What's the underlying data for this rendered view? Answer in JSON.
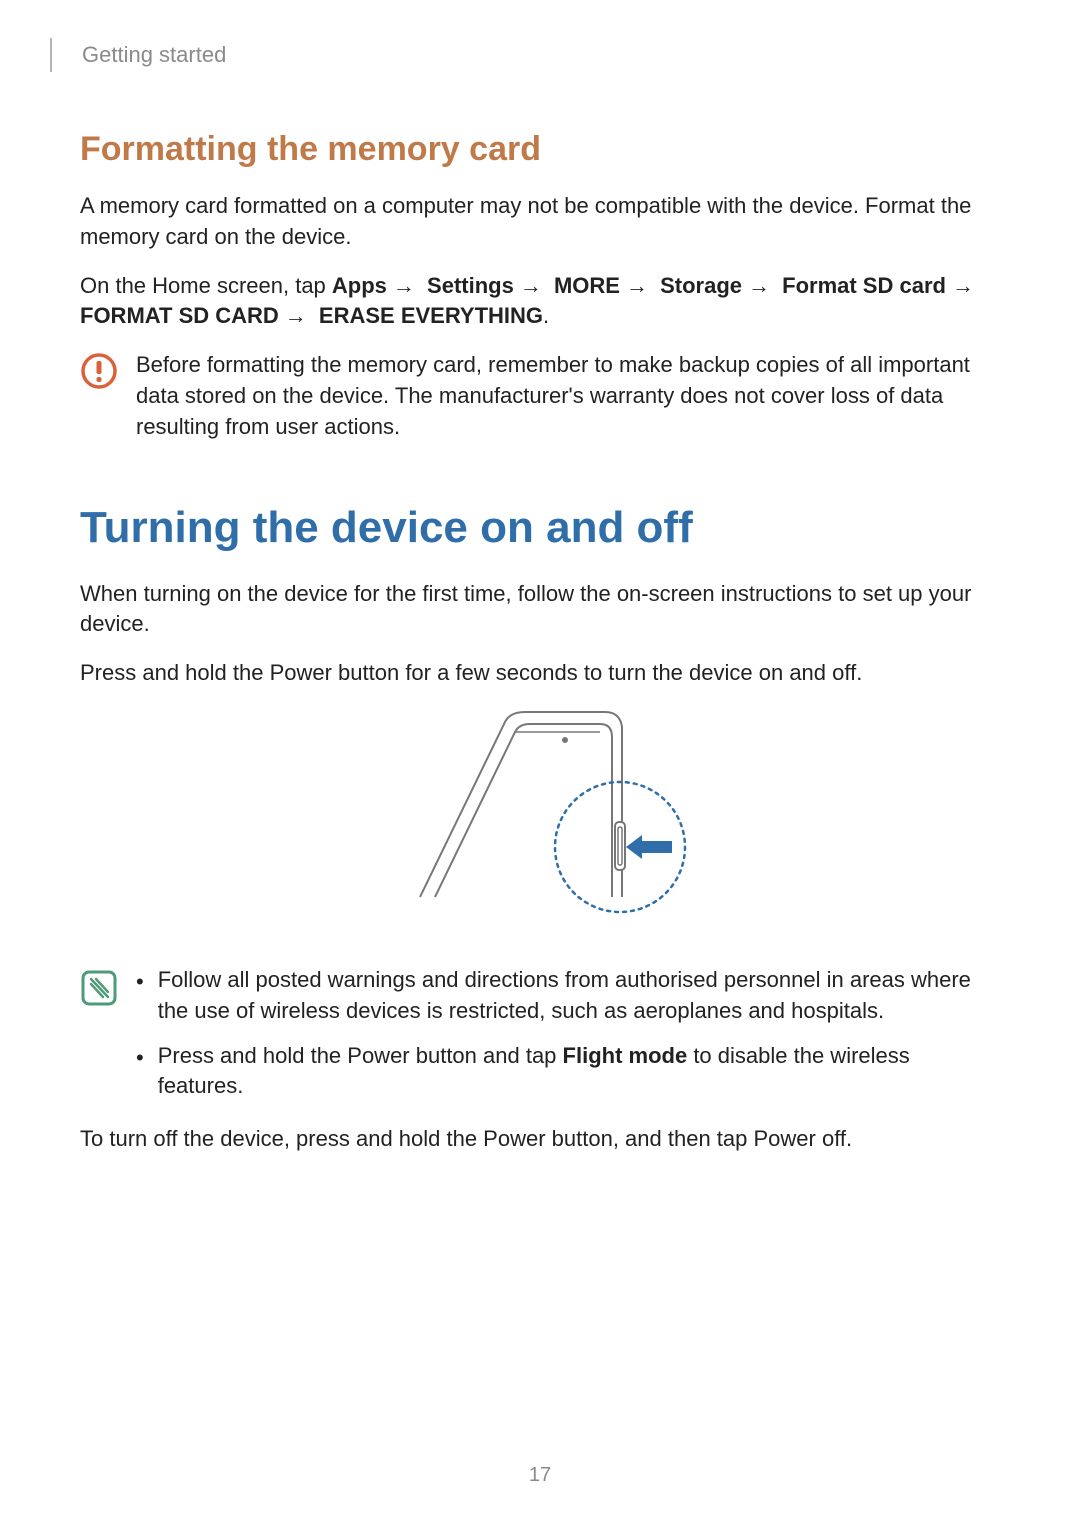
{
  "header": {
    "section": "Getting started"
  },
  "formatting": {
    "heading": "Formatting the memory card",
    "p1": "A memory card formatted on a computer may not be compatible with the device. Format the memory card on the device.",
    "path_intro": "On the Home screen, tap ",
    "path_items": [
      "Apps",
      "Settings",
      "MORE",
      "Storage",
      "Format SD card",
      "FORMAT SD CARD",
      "ERASE EVERYTHING"
    ],
    "path_end": ".",
    "caution": "Before formatting the memory card, remember to make backup copies of all important data stored on the device. The manufacturer's warranty does not cover loss of data resulting from user actions."
  },
  "power": {
    "heading": "Turning the device on and off",
    "p1": "When turning on the device for the first time, follow the on-screen instructions to set up your device.",
    "p2": "Press and hold the Power button for a few seconds to turn the device on and off.",
    "bullet1": "Follow all posted warnings and directions from authorised personnel in areas where the use of wireless devices is restricted, such as aeroplanes and hospitals.",
    "bullet2_pre": "Press and hold the Power button and tap ",
    "bullet2_bold": "Flight mode",
    "bullet2_post": " to disable the wireless features.",
    "p3_pre": "To turn off the device, press and hold the Power button, and then tap ",
    "p3_bold": "Power off",
    "p3_post": "."
  },
  "page_number": "17"
}
